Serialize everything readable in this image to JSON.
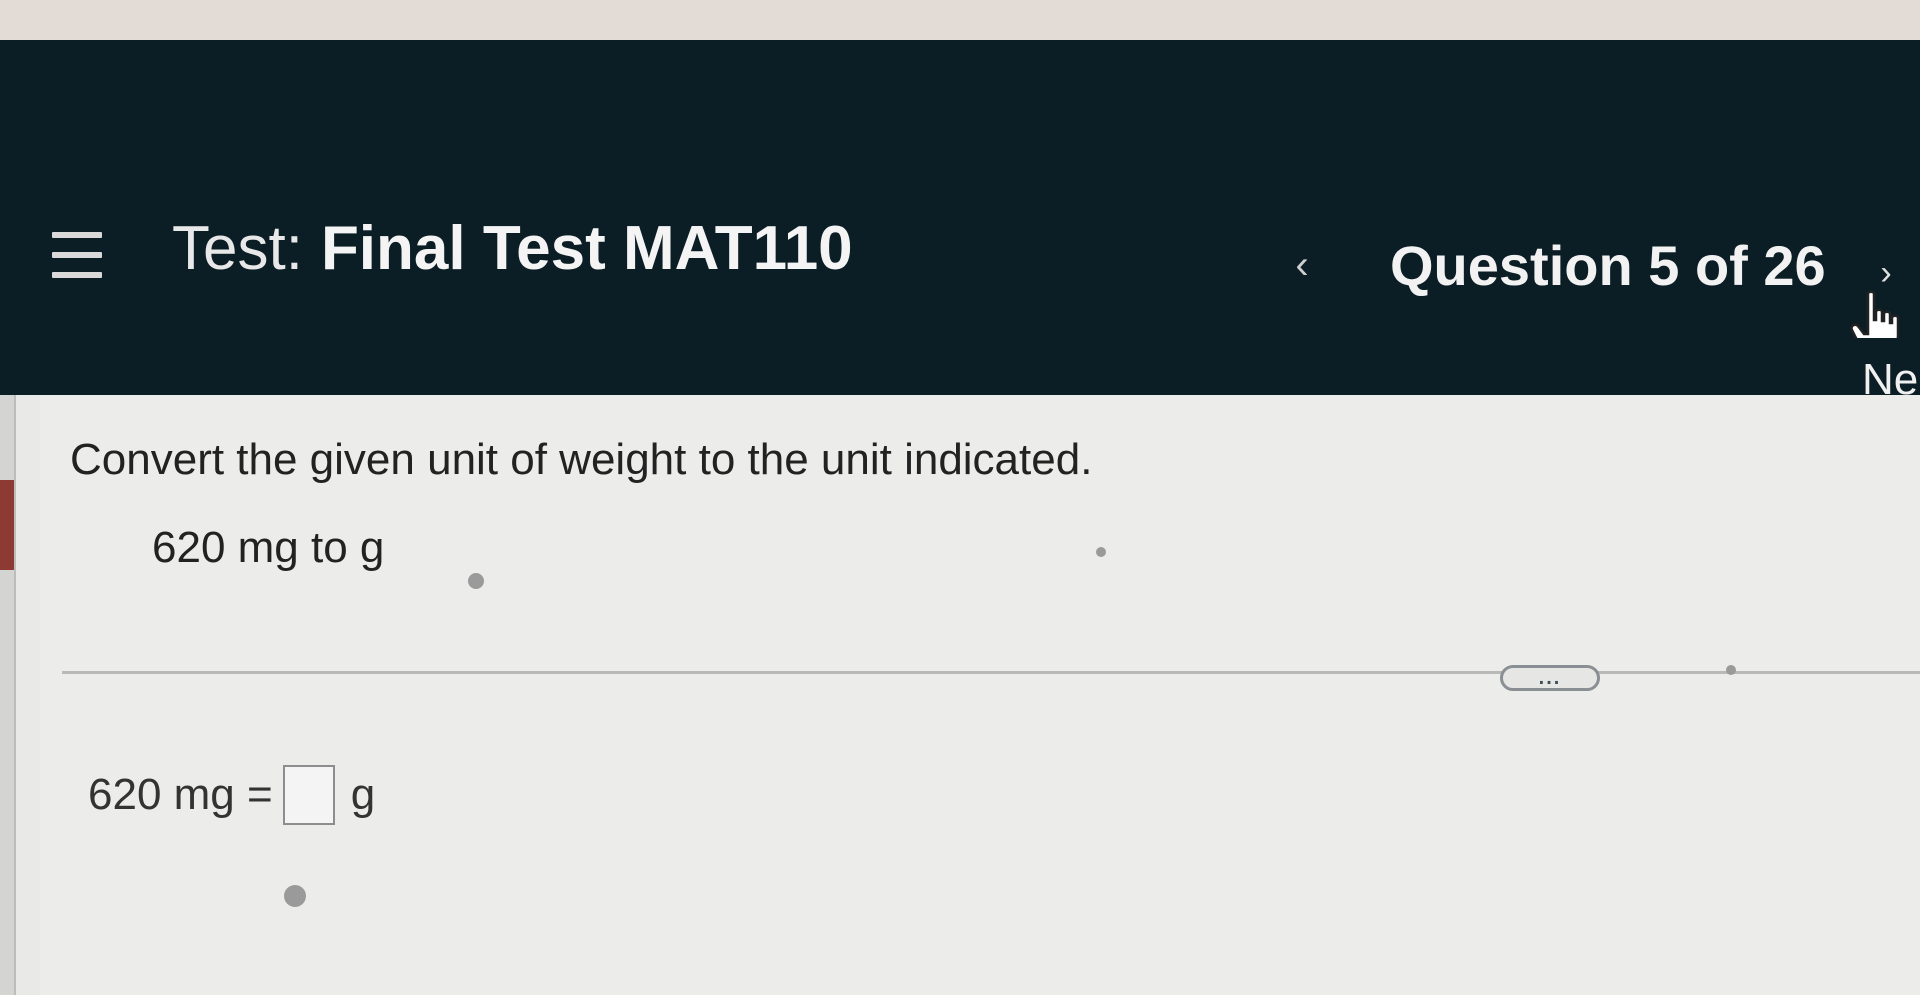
{
  "header": {
    "menu_icon": "hamburger-menu-icon",
    "title_prefix": "Test:",
    "title_name": "Final Test MAT110",
    "prev_label": "‹",
    "question_counter": "Question 5 of 26",
    "next_label": "›",
    "next_tab_label": "Ne",
    "background_color": "#0c1e25"
  },
  "question": {
    "instruction": "Convert the given unit of weight to the unit indicated.",
    "problem": "620 mg to g",
    "more_button_label": "...",
    "answer_left": "620 mg =",
    "answer_unit": "g",
    "answer_value": ""
  }
}
